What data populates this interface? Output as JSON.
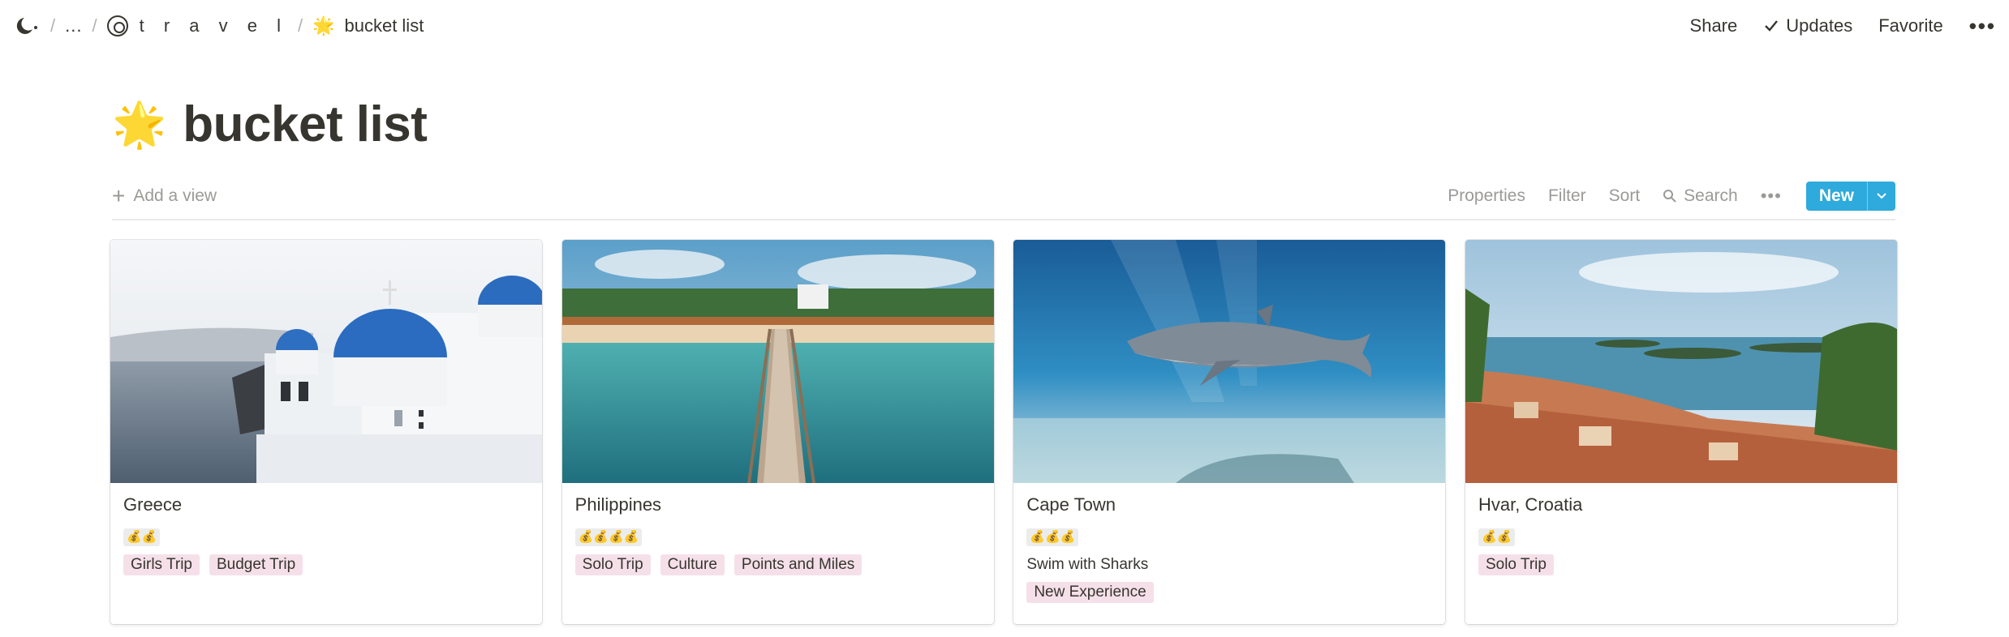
{
  "breadcrumb": {
    "ellipsis": "...",
    "workspace": "t r a v e l",
    "page_emoji": "🌟",
    "page": "bucket list"
  },
  "top_actions": {
    "share": "Share",
    "updates": "Updates",
    "favorite": "Favorite",
    "more": "•••"
  },
  "page": {
    "emoji": "🌟",
    "title": "bucket list"
  },
  "view_bar": {
    "add_view": "Add a view",
    "properties": "Properties",
    "filter": "Filter",
    "sort": "Sort",
    "search": "Search",
    "more": "•••",
    "new": "New"
  },
  "colors": {
    "accent": "#2eaadc",
    "tag_pink": "#f5e0e9",
    "text": "#37352f",
    "muted": "#9b9a97"
  },
  "cards": [
    {
      "name": "Greece",
      "cost": "💰💰",
      "tags": [
        "Girls Trip",
        "Budget Trip"
      ],
      "cover_icon": "santorini-image"
    },
    {
      "name": "Philippines",
      "cost": "💰💰💰💰",
      "tags": [
        "Solo Trip",
        "Culture",
        "Points and Miles"
      ],
      "cover_icon": "pier-beach-image"
    },
    {
      "name": "Cape Town",
      "cost": "💰💰💰",
      "note": "Swim with Sharks",
      "tags": [
        "New Experience"
      ],
      "cover_icon": "shark-underwater-image"
    },
    {
      "name": "Hvar, Croatia",
      "cost": "💰💰",
      "tags": [
        "Solo Trip"
      ],
      "cover_icon": "coastal-town-image"
    }
  ]
}
